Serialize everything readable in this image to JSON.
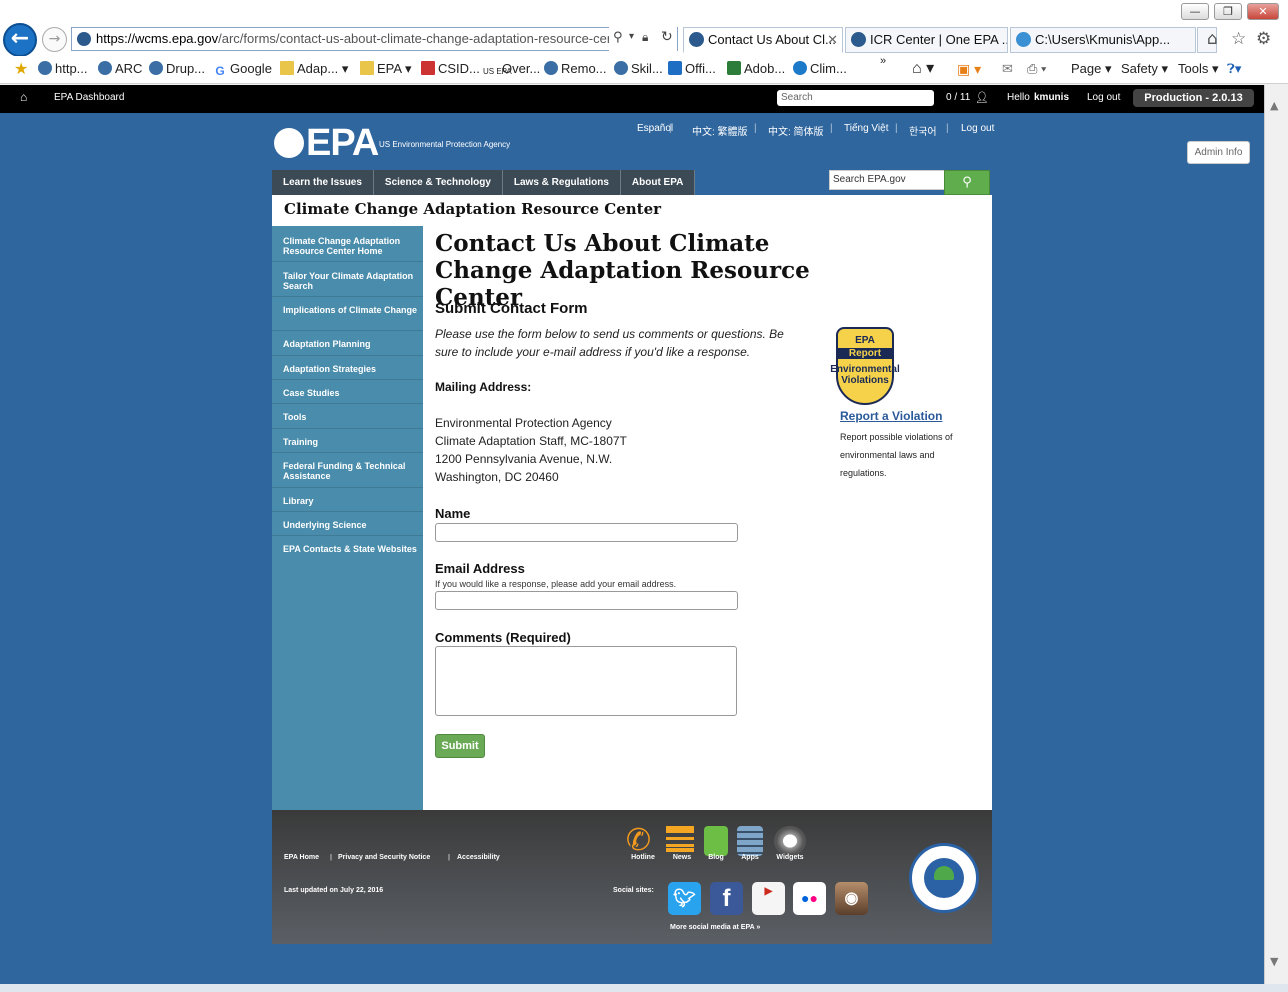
{
  "browser": {
    "url_domain": "https://wcms.epa.gov",
    "url_path": "/arc/forms/contact-us-about-climate-change-adaptation-resource-center",
    "tabs": [
      {
        "label": "Contact Us About Cl..."
      },
      {
        "label": "ICR Center | One EPA ..."
      },
      {
        "label": "C:\\Users\\Kmunis\\App..."
      }
    ],
    "favorites": [
      "http...",
      "ARC",
      "Drup...",
      "Google",
      "Adap...",
      "EPA",
      "CSID...",
      "Over...",
      "Remo...",
      "Skil...",
      "Offi...",
      "Adob...",
      "Clim..."
    ],
    "fav_us_epa_label": "US EPA",
    "commands": [
      "Page",
      "Safety",
      "Tools"
    ]
  },
  "admin_bar": {
    "dashboard": "EPA Dashboard",
    "search_placeholder": "Search",
    "count": "0 / 11",
    "hello": "Hello",
    "user": "kmunis",
    "logout": "Log out",
    "environment": "Production - 2.0.13"
  },
  "header": {
    "logo": "EPA",
    "agency": "US Environmental Protection Agency",
    "languages": [
      "Español",
      "中文: 繁體版",
      "中文: 简体版",
      "Tiếng Việt",
      "한국어",
      "Log out"
    ],
    "admin_info": "Admin Info",
    "nav": [
      "Learn the Issues",
      "Science & Technology",
      "Laws & Regulations",
      "About EPA"
    ],
    "search_placeholder": "Search EPA.gov"
  },
  "site_name": "Climate Change Adaptation Resource Center",
  "sidenav": [
    "Climate Change Adaptation Resource Center Home",
    "Tailor Your Climate Adaptation Search",
    "Implications of Climate Change",
    "Adaptation Planning",
    "Adaptation Strategies",
    "Case Studies",
    "Tools",
    "Training",
    "Federal Funding & Technical Assistance",
    "Library",
    "Underlying Science",
    "EPA Contacts & State Websites"
  ],
  "main": {
    "title": "Contact Us About Climate Change Adaptation Resource Center",
    "form_heading": "Submit Contact Form",
    "intro": "Please use the form below to send us comments or questions. Be sure to include your e-mail address if you'd like a response.",
    "mailing_heading": "Mailing Address:",
    "address": [
      "Environmental Protection Agency",
      "Climate Adaptation Staff, MC-1807T",
      "1200 Pennsylvania Avenue, N.W.",
      "Washington, DC 20460"
    ],
    "name_label": "Name",
    "email_label": "Email Address",
    "email_hint": "If you would like a response, please add your email address.",
    "comments_label": "Comments (Required)",
    "submit": "Submit"
  },
  "sidebar_right": {
    "badge_lines": [
      "EPA",
      "Report",
      "Environmental",
      "Violations"
    ],
    "link": "Report a Violation",
    "desc": "Report possible violations of environmental laws and regulations."
  },
  "footer": {
    "links": [
      "EPA Home",
      "Privacy and Security Notice",
      "Accessibility"
    ],
    "last_updated": "Last updated on July 22, 2016",
    "tools": [
      "Hotline",
      "News",
      "Blog",
      "Apps",
      "Widgets"
    ],
    "social_label": "Social sites:",
    "more_social": "More social media at EPA »"
  }
}
